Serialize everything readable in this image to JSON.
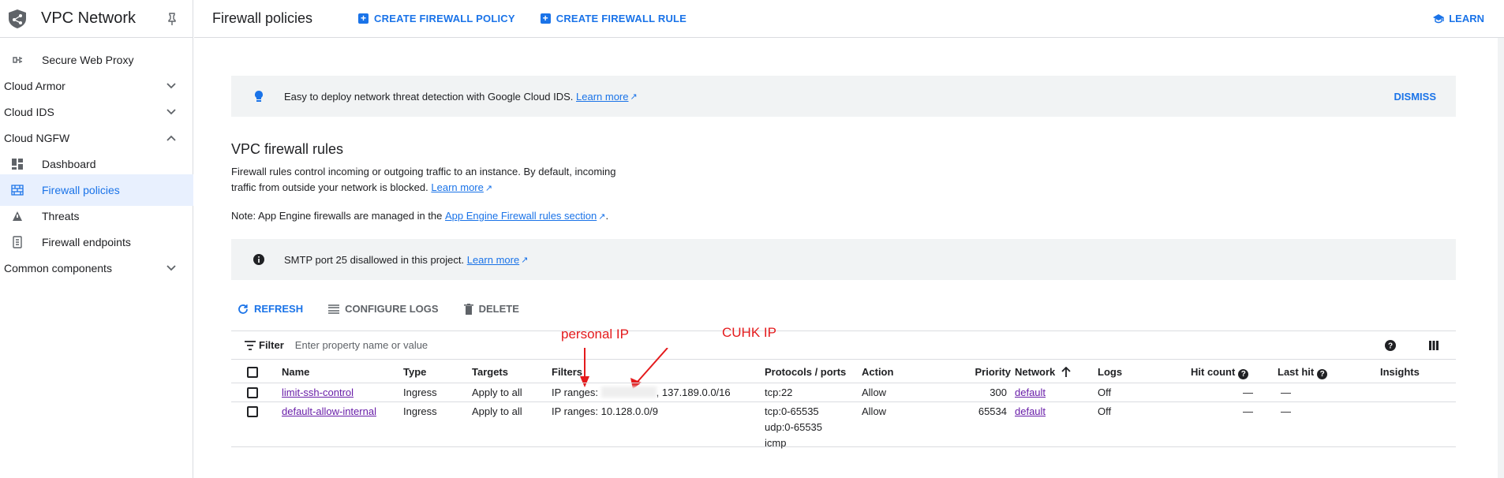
{
  "sidebar": {
    "title": "VPC Network",
    "items": [
      {
        "label": "Secure Web Proxy",
        "icon": "proxy-icon"
      },
      {
        "label": "Cloud Armor"
      },
      {
        "label": "Cloud IDS"
      },
      {
        "label": "Cloud NGFW"
      },
      {
        "label": "Dashboard",
        "icon": "dashboard-icon"
      },
      {
        "label": "Firewall policies",
        "icon": "firewall-icon",
        "active": true
      },
      {
        "label": "Threats",
        "icon": "threats-icon"
      },
      {
        "label": "Firewall endpoints",
        "icon": "endpoint-icon"
      },
      {
        "label": "Common components"
      }
    ]
  },
  "topbar": {
    "title": "Firewall policies",
    "create_policy": "CREATE FIREWALL POLICY",
    "create_rule": "CREATE FIREWALL RULE",
    "learn": "LEARN"
  },
  "ids_banner": {
    "text": "Easy to deploy network threat detection with Google Cloud IDS.",
    "link": "Learn more",
    "dismiss": "DISMISS"
  },
  "section": {
    "title": "VPC firewall rules",
    "desc_line1": "Firewall rules control incoming or outgoing traffic to an instance. By default, incoming",
    "desc_line2": "traffic from outside your network is blocked.",
    "desc_link": "Learn more",
    "note_text": "Note: App Engine firewalls are managed in the",
    "note_link": "App Engine Firewall rules section",
    "note_end": "."
  },
  "smtp_banner": {
    "text": "SMTP port 25 disallowed in this project.",
    "link": "Learn more"
  },
  "actions": {
    "refresh": "REFRESH",
    "configure_logs": "CONFIGURE LOGS",
    "delete": "DELETE"
  },
  "filter": {
    "label": "Filter",
    "placeholder": "Enter property name or value"
  },
  "annotations": {
    "personal": "personal IP",
    "cuhk": "CUHK IP"
  },
  "table": {
    "headers": {
      "name": "Name",
      "type": "Type",
      "targets": "Targets",
      "filters": "Filters",
      "protocols": "Protocols / ports",
      "action": "Action",
      "priority": "Priority",
      "network": "Network",
      "logs": "Logs",
      "hit_count": "Hit count",
      "last_hit": "Last hit",
      "insights": "Insights"
    },
    "rows": [
      {
        "name": "limit-ssh-control",
        "type": "Ingress",
        "targets": "Apply to all",
        "filters_prefix": "IP ranges:",
        "filters_suffix": ", 137.189.0.0/16",
        "protocols": [
          "tcp:22"
        ],
        "action": "Allow",
        "priority": "300",
        "network": "default",
        "logs": "Off",
        "hit_count": "—",
        "last_hit": "—"
      },
      {
        "name": "default-allow-internal",
        "type": "Ingress",
        "targets": "Apply to all",
        "filters_prefix": "IP ranges: 10.128.0.0/9",
        "filters_suffix": "",
        "protocols": [
          "tcp:0-65535",
          "udp:0-65535",
          "icmp"
        ],
        "action": "Allow",
        "priority": "65534",
        "network": "default",
        "logs": "Off",
        "hit_count": "—",
        "last_hit": "—"
      }
    ]
  }
}
